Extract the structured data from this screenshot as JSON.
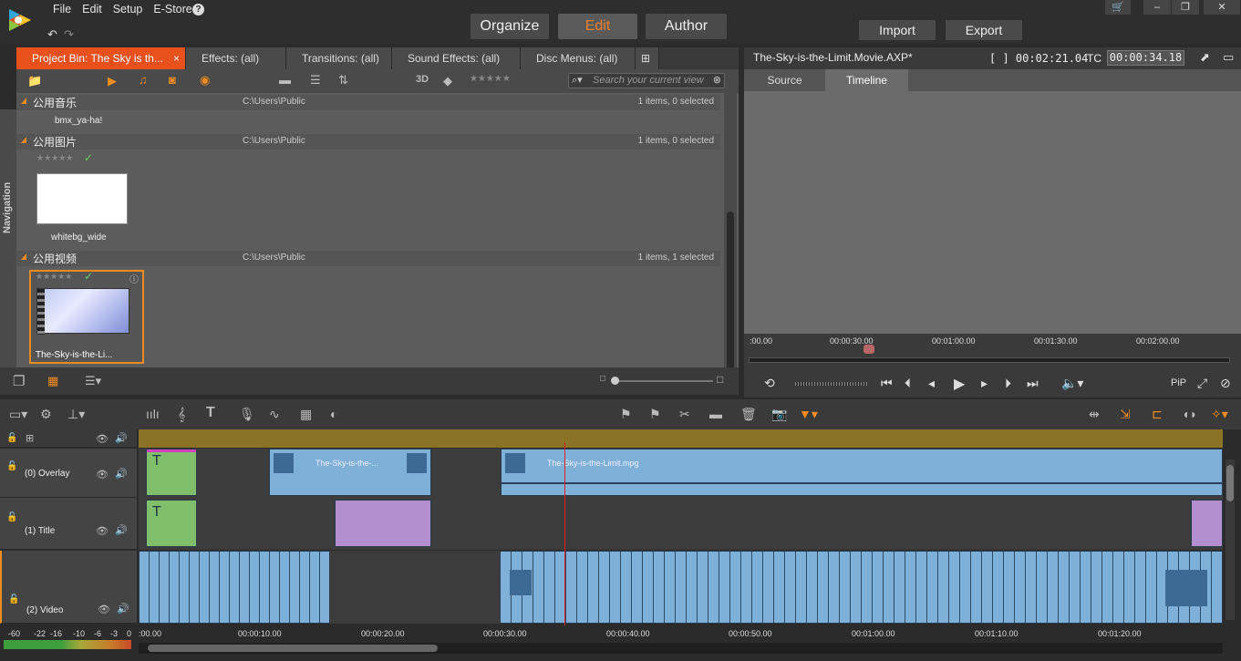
{
  "menu": {
    "file": "File",
    "edit": "Edit",
    "setup": "Setup",
    "estore": "E-Store",
    "help": "?"
  },
  "modes": {
    "organize": "Organize",
    "edit": "Edit",
    "author": "Author"
  },
  "io": {
    "import": "Import",
    "export": "Export"
  },
  "library": {
    "tabs": [
      {
        "label": "Project Bin: The Sky is th...",
        "close": "×"
      },
      {
        "label": "Effects: (all)"
      },
      {
        "label": "Transitions: (all)"
      },
      {
        "label": "Sound Effects: (all)"
      },
      {
        "label": "Disc Menus: (all)"
      }
    ],
    "toolbar": {
      "three_d": "3D",
      "search_placeholder": "Search your current view"
    },
    "navigation_label": "Navigation",
    "sections": [
      {
        "name": "公用音乐",
        "path": "C:\\Users\\Public",
        "count": "1 items, 0 selected",
        "items": [
          {
            "name": "bmx_ya-ha!"
          }
        ]
      },
      {
        "name": "公用图片",
        "path": "C:\\Users\\Public",
        "count": "1 items, 0 selected",
        "items": [
          {
            "name": "whitebg_wide"
          }
        ]
      },
      {
        "name": "公用视频",
        "path": "C:\\Users\\Public",
        "count": "1 items, 1 selected",
        "items": [
          {
            "name": "The-Sky-is-the-Li..."
          }
        ]
      }
    ]
  },
  "player": {
    "title": "The-Sky-is-the-Limit.Movie.AXP*",
    "duration": "[ ] 00:02:21.04",
    "tc_label": "TC",
    "tc": "00:00:34.18",
    "tabs": {
      "source": "Source",
      "timeline": "Timeline"
    },
    "ruler": [
      ":00.00",
      "00:00:30.00",
      "00:01:00.00",
      "00:01:30.00",
      "00:02:00.00"
    ],
    "pip": "PiP"
  },
  "timeline": {
    "tracks": [
      {
        "name": "(0) Overlay"
      },
      {
        "name": "(1) Title"
      },
      {
        "name": "(2) Video"
      }
    ],
    "clips": {
      "overlay_clip1": "The-Sky-is-the-...",
      "overlay_clip2": "The-Sky-is-the-Limit.mpg",
      "title_letter": "T"
    },
    "ruler": [
      ":00.00",
      "00:00:10.00",
      "00:00:20.00",
      "00:00:30.00",
      "00:00:40.00",
      "00:00:50.00",
      "00:01:00.00",
      "00:01:10.00",
      "00:01:20.00"
    ],
    "meter": [
      "-60",
      "-22",
      "-16",
      "-10",
      "-6",
      "-3",
      "0"
    ]
  }
}
